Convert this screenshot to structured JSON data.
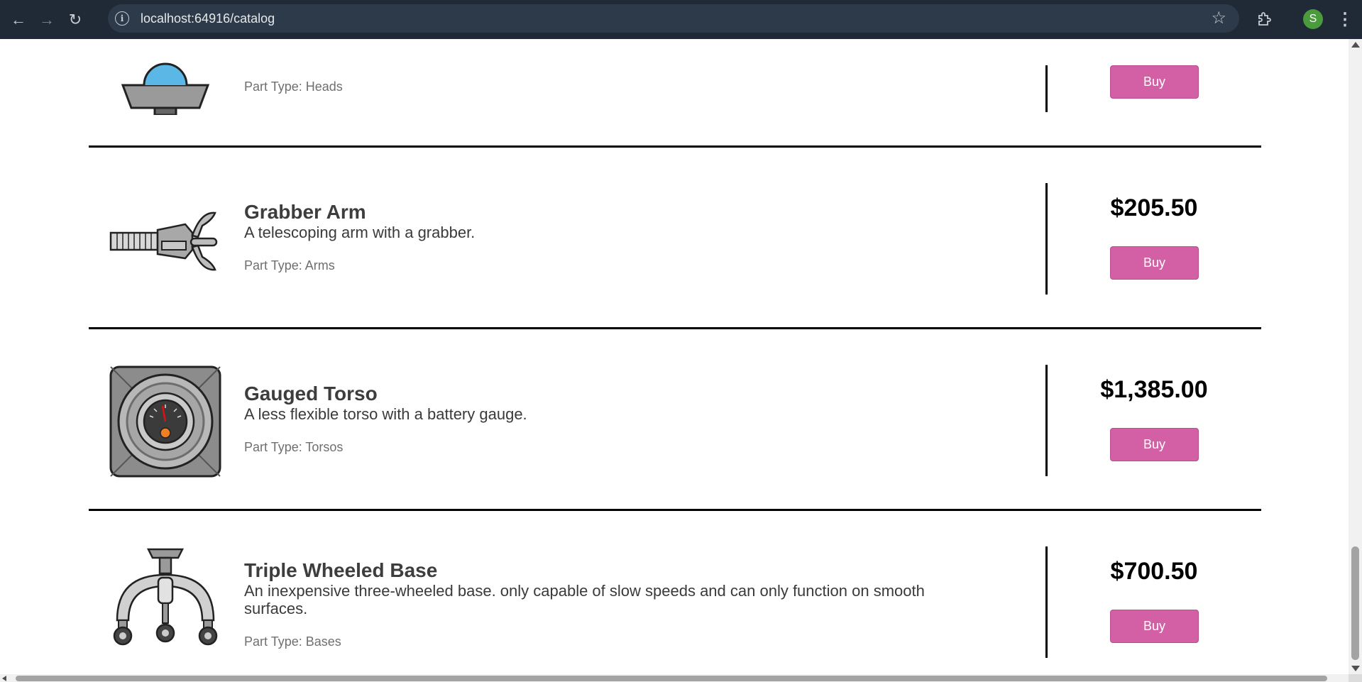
{
  "browser": {
    "url": "localhost:64916/catalog",
    "avatar_initial": "S"
  },
  "catalog": {
    "items": [
      {
        "title": "",
        "description": "",
        "part_type": "Part Type: Heads",
        "price": "",
        "buy_label": "Buy",
        "image_icon": "robot-head-icon"
      },
      {
        "title": "Grabber Arm",
        "description": "A telescoping arm with a grabber.",
        "part_type": "Part Type: Arms",
        "price": "$205.50",
        "buy_label": "Buy",
        "image_icon": "grabber-arm-icon"
      },
      {
        "title": "Gauged Torso",
        "description": "A less flexible torso with a battery gauge.",
        "part_type": "Part Type: Torsos",
        "price": "$1,385.00",
        "buy_label": "Buy",
        "image_icon": "gauged-torso-icon"
      },
      {
        "title": "Triple Wheeled Base",
        "description": "An inexpensive three-wheeled base. only capable of slow speeds and can only function on smooth surfaces.",
        "part_type": "Part Type: Bases",
        "price": "$700.50",
        "buy_label": "Buy",
        "image_icon": "wheeled-base-icon"
      }
    ]
  },
  "colors": {
    "buy_button": "#d35fa5",
    "chrome_bg": "#202a36"
  }
}
